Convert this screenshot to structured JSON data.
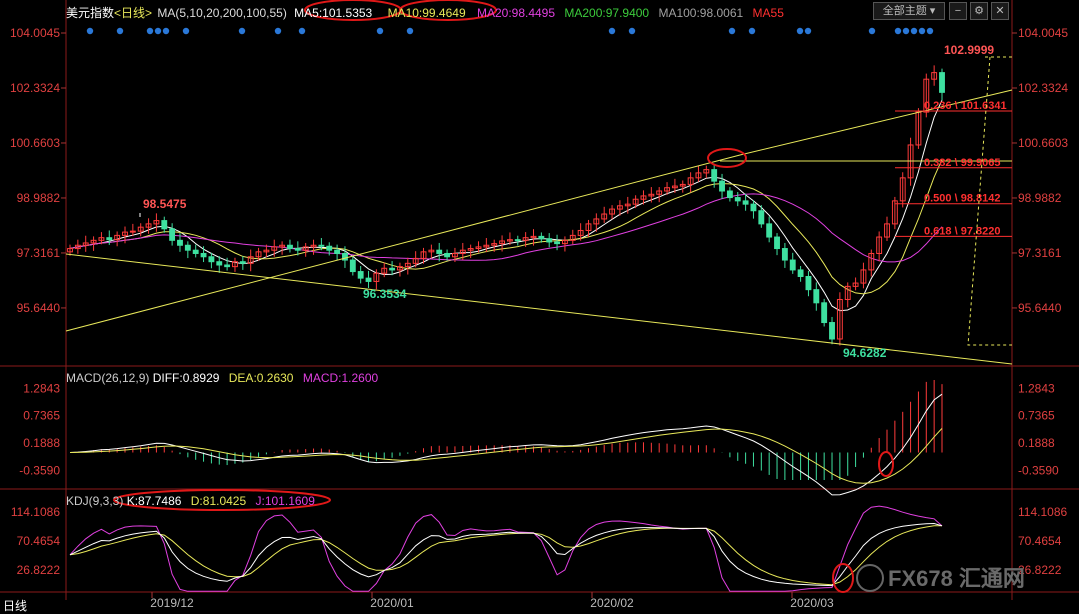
{
  "toolbar": {
    "theme_label": "全部主题",
    "period_tag": "日线"
  },
  "main_legend": {
    "title": "美元指数",
    "period": "<日线>",
    "params": "MA(5,10,20,200,100,55)",
    "items": [
      {
        "text": "MA5:101.5353",
        "color": "#ffffff"
      },
      {
        "text": "MA10:99.4649",
        "color": "#e8e85a"
      },
      {
        "text": "MA20:98.4495",
        "color": "#e040e0"
      },
      {
        "text": "MA200:97.9400",
        "color": "#3ccc3c"
      },
      {
        "text": "MA100:98.0061",
        "color": "#a0a0a0"
      },
      {
        "text": "MA55",
        "color": "#ff3030"
      }
    ]
  },
  "macd_legend": {
    "items": [
      {
        "text": "MACD(26,12,9)",
        "color": "#cccccc"
      },
      {
        "text": "DIFF:0.8929",
        "color": "#ffffff"
      },
      {
        "text": "DEA:0.2630",
        "color": "#e8e85a"
      },
      {
        "text": "MACD:1.2600",
        "color": "#e040e0"
      }
    ]
  },
  "kdj_legend": {
    "items": [
      {
        "text": "KDJ(9,3,3)",
        "color": "#cccccc"
      },
      {
        "text": "K:87.7486",
        "color": "#ffffff"
      },
      {
        "text": "D:81.0425",
        "color": "#e8e85a"
      },
      {
        "text": "J:101.1609",
        "color": "#e040e0"
      }
    ]
  },
  "chart_data": [
    {
      "type": "candlestick",
      "title": "美元指数",
      "y_ticks": [
        "104.0045",
        "102.3324",
        "100.6603",
        "98.9882",
        "97.3161",
        "95.6440"
      ],
      "ylim": [
        94.0,
        104.4
      ],
      "x_ticks": [
        "2019/12",
        "2020/01",
        "2020/02",
        "2020/03"
      ],
      "annotations": [
        {
          "text": "98.5475",
          "kind": "high"
        },
        {
          "text": "96.3534",
          "kind": "low"
        },
        {
          "text": "94.6282",
          "kind": "low"
        },
        {
          "text": "102.9999",
          "kind": "high"
        }
      ],
      "fib_levels": [
        {
          "text": "0.236 \\ 101.6341",
          "value": 101.634
        },
        {
          "text": "0.382 \\ 99.9065",
          "value": 99.907
        },
        {
          "text": "0.500 \\ 98.8142",
          "value": 98.814
        },
        {
          "text": "0.618 \\ 97.8220",
          "value": 97.822
        }
      ],
      "close": [
        97.45,
        97.55,
        97.62,
        97.7,
        97.78,
        97.72,
        97.85,
        97.95,
        97.98,
        98.1,
        98.2,
        98.3,
        98.05,
        97.7,
        97.55,
        97.4,
        97.3,
        97.2,
        97.05,
        96.95,
        96.9,
        97.05,
        97.0,
        97.2,
        97.35,
        97.4,
        97.5,
        97.55,
        97.45,
        97.4,
        97.5,
        97.55,
        97.52,
        97.4,
        97.3,
        97.1,
        96.75,
        96.55,
        96.45,
        96.7,
        96.85,
        96.8,
        96.9,
        97.0,
        97.15,
        97.35,
        97.4,
        97.3,
        97.2,
        97.3,
        97.4,
        97.45,
        97.5,
        97.55,
        97.6,
        97.68,
        97.72,
        97.7,
        97.78,
        97.82,
        97.75,
        97.65,
        97.6,
        97.7,
        97.85,
        98.0,
        98.2,
        98.35,
        98.5,
        98.65,
        98.75,
        98.8,
        98.95,
        99.05,
        99.1,
        99.2,
        99.3,
        99.35,
        99.4,
        99.6,
        99.75,
        99.85,
        99.5,
        99.2,
        99.0,
        98.9,
        98.8,
        98.6,
        98.2,
        97.8,
        97.45,
        97.1,
        96.8,
        96.6,
        96.2,
        95.8,
        95.2,
        94.7,
        95.9,
        96.3,
        96.4,
        96.8,
        97.3,
        97.8,
        98.2,
        98.9,
        99.6,
        100.6,
        101.6,
        102.6,
        102.8,
        102.2
      ],
      "series": [
        {
          "name": "MA5",
          "window": 5,
          "color": "#ffffff"
        },
        {
          "name": "MA10",
          "window": 10,
          "color": "#e8e85a"
        },
        {
          "name": "MA20",
          "window": 20,
          "color": "#e040e0"
        }
      ]
    },
    {
      "type": "bar",
      "title": "MACD(26,12,9)",
      "y_ticks": [
        "1.2843",
        "0.7365",
        "0.1888",
        "-0.3590"
      ],
      "ylim": [
        -0.55,
        1.45
      ],
      "series": [
        {
          "name": "DIFF",
          "color": "#ffffff"
        },
        {
          "name": "DEA",
          "color": "#e8e85a"
        },
        {
          "name": "MACD",
          "color": "#e040e0"
        }
      ]
    },
    {
      "type": "line",
      "title": "KDJ(9,3,3)",
      "y_ticks": [
        "114.1086",
        "70.4654",
        "26.8222"
      ],
      "ylim": [
        0,
        125
      ],
      "series": [
        {
          "name": "K",
          "color": "#ffffff"
        },
        {
          "name": "D",
          "color": "#e8e85a"
        },
        {
          "name": "J",
          "color": "#e040e0"
        }
      ]
    }
  ],
  "watermark": {
    "text": "FX678 汇通网"
  }
}
